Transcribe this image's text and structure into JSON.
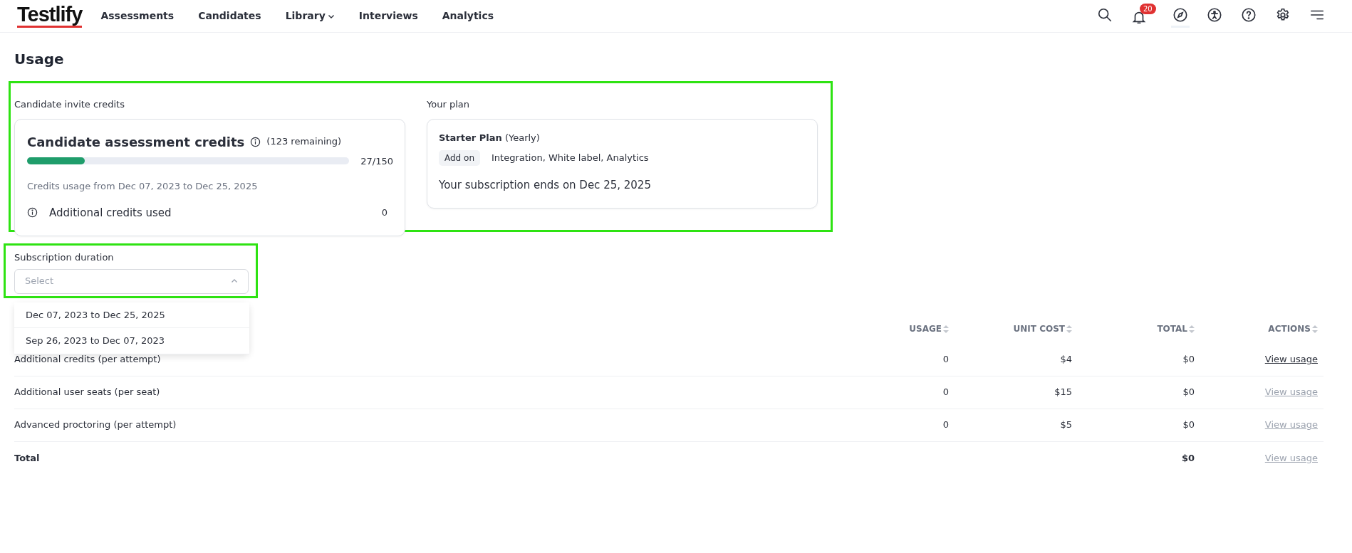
{
  "nav": {
    "logo": "Testlify",
    "items": [
      {
        "label": "Assessments",
        "dropdown": false
      },
      {
        "label": "Candidates",
        "dropdown": false
      },
      {
        "label": "Library",
        "dropdown": true
      },
      {
        "label": "Interviews",
        "dropdown": false
      },
      {
        "label": "Analytics",
        "dropdown": false
      }
    ],
    "icons": [
      {
        "kind": "search",
        "selected": false
      },
      {
        "kind": "bell",
        "badge": "20",
        "selected": false
      },
      {
        "kind": "compass",
        "selected": true
      },
      {
        "kind": "accessibility",
        "selected": false
      },
      {
        "kind": "help",
        "selected": false
      },
      {
        "kind": "settings",
        "selected": false
      },
      {
        "kind": "menu",
        "selected": false
      }
    ]
  },
  "page_title": "Usage",
  "credits": {
    "label": "Candidate invite credits",
    "title": "Candidate assessment credits",
    "remaining": "(123 remaining)",
    "level": 0.18,
    "count": "27/150",
    "period": "Credits usage from Dec 07, 2023 to Dec 25, 2025",
    "additional_label": "Additional credits used",
    "additional_value": "0"
  },
  "plan": {
    "label": "Your plan",
    "name": "Starter Plan",
    "cycle": "(Yearly)",
    "addon_tag": "Add on",
    "addons": "Integration, White label, Analytics",
    "ends": "Your subscription ends on Dec 25, 2025"
  },
  "duration": {
    "label": "Subscription duration",
    "placeholder": "Select",
    "expanded": true,
    "options": [
      {
        "label": "Dec 07, 2023 to Dec 25, 2025",
        "selected": false
      },
      {
        "label": "Sep 26, 2023 to Dec 07, 2023",
        "selected": false
      }
    ]
  },
  "table": {
    "columns": [
      {
        "label": "USAGE",
        "sortable": true
      },
      {
        "label": "UNIT COST",
        "sortable": true
      },
      {
        "label": "TOTAL",
        "sortable": true
      },
      {
        "label": "ACTIONS",
        "sortable": true
      }
    ],
    "rows": [
      {
        "item": "Additional credits (per attempt)",
        "usage": "0",
        "unit_cost": "$4",
        "total": "$0",
        "action": "View usage",
        "disabled": false
      },
      {
        "item": "Additional user seats (per seat)",
        "usage": "0",
        "unit_cost": "$15",
        "total": "$0",
        "action": "View usage",
        "disabled": true
      },
      {
        "item": "Advanced proctoring (per attempt)",
        "usage": "0",
        "unit_cost": "$5",
        "total": "$0",
        "action": "View usage",
        "disabled": true
      }
    ],
    "total_row": {
      "label": "Total",
      "total": "$0",
      "action": "View usage",
      "disabled": true
    }
  }
}
